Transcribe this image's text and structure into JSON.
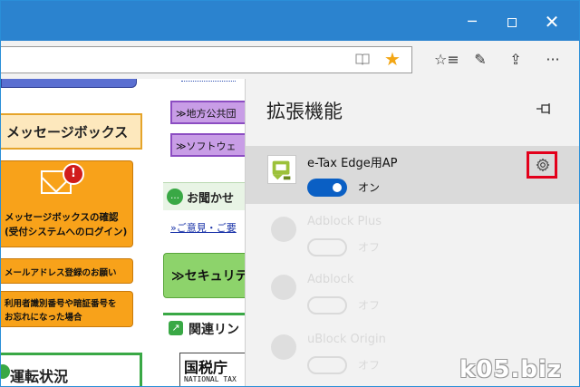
{
  "window": {
    "minimize": "─",
    "maximize": "",
    "close": "✕"
  },
  "toolbar": {
    "favorite_star": "★",
    "hub_icon": "☆≡",
    "note_icon": "✎",
    "share_icon": "⇪",
    "more_icon": "···"
  },
  "page": {
    "message_box_heading": "メッセージボックス",
    "badge": "!",
    "message_box_line1": "メッセージボックスの確認",
    "message_box_line2": "(受付システムへのログイン)",
    "email_registration": "メールアドレス登録のお願い",
    "forgot_line1": "利用者識別番号や暗証番号を",
    "forgot_line2": "お忘れになった場合",
    "operation_status": "運転状況",
    "local_gov_link": "≫地方公共団",
    "software_link": "≫ソフトウェ",
    "inquiry_heading": "お聞かせ",
    "feedback_link": "»ご意見・ご要",
    "security_button": "≫セキュリテ",
    "related_links": "関連リン",
    "nta_big": "国税庁",
    "nta_small": "NATIONAL TAX"
  },
  "extensions_panel": {
    "title": "拡張機能",
    "extension": {
      "name": "e-Tax Edge用AP",
      "toggle_label": "オン",
      "enabled": true
    },
    "faded_extensions": [
      {
        "name": "Adblock Plus",
        "toggle_label": "オフ"
      },
      {
        "name": "Adblock",
        "toggle_label": "オフ"
      },
      {
        "name": "uBlock Origin",
        "toggle_label": "オフ"
      }
    ]
  },
  "watermark": "k05.biz",
  "colors": {
    "titlebar": "#2b83cf",
    "star": "#f3a614",
    "toggle_on": "#0a5fc4",
    "highlight_box": "#e3001b"
  }
}
